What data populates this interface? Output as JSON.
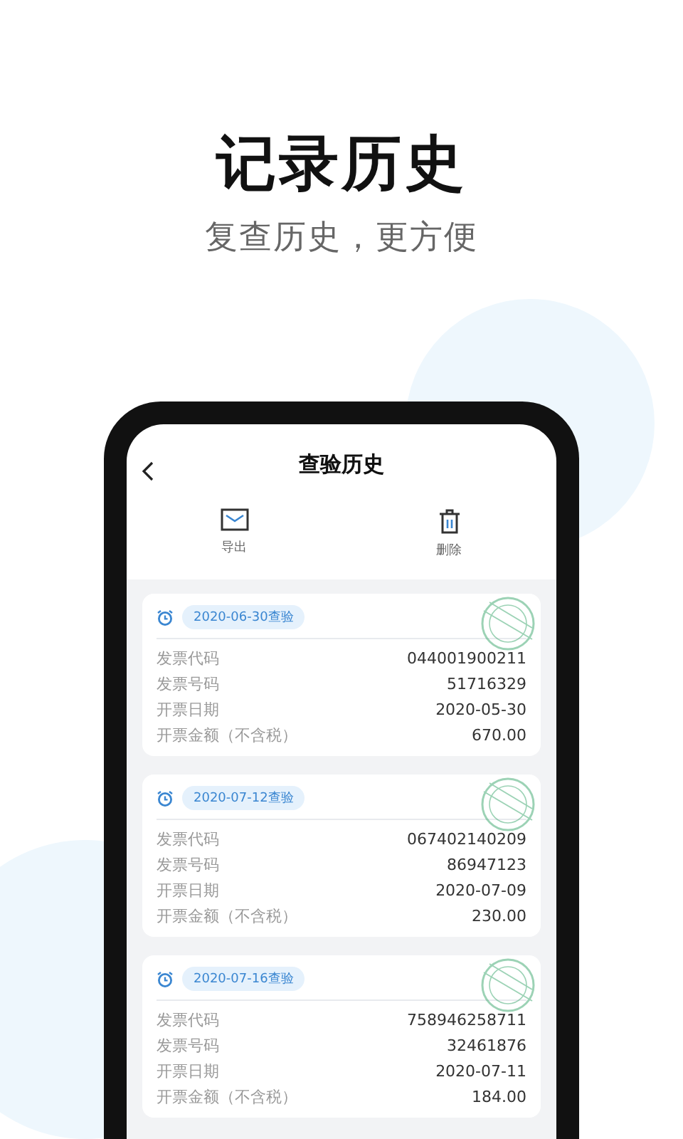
{
  "headline": "记录历史",
  "subtitle": "复查历史，更方便",
  "screen": {
    "title": "查验历史",
    "actions": [
      {
        "kind": "export",
        "label": "导出"
      },
      {
        "kind": "delete",
        "label": "删除"
      }
    ],
    "records": [
      {
        "checked_on": "2020-06-30查验",
        "fields": [
          {
            "label": "发票代码",
            "value": "044001900211"
          },
          {
            "label": "发票号码",
            "value": "51716329"
          },
          {
            "label": "开票日期",
            "value": "2020-05-30"
          },
          {
            "label": "开票金额（不含税）",
            "value": "670.00"
          }
        ]
      },
      {
        "checked_on": "2020-07-12查验",
        "fields": [
          {
            "label": "发票代码",
            "value": "067402140209"
          },
          {
            "label": "发票号码",
            "value": "86947123"
          },
          {
            "label": "开票日期",
            "value": "2020-07-09"
          },
          {
            "label": "开票金额（不含税）",
            "value": "230.00"
          }
        ]
      },
      {
        "checked_on": "2020-07-16查验",
        "fields": [
          {
            "label": "发票代码",
            "value": "758946258711"
          },
          {
            "label": "发票号码",
            "value": "32461876"
          },
          {
            "label": "开票日期",
            "value": "2020-07-11"
          },
          {
            "label": "开票金额（不含税）",
            "value": "184.00"
          }
        ]
      }
    ]
  }
}
